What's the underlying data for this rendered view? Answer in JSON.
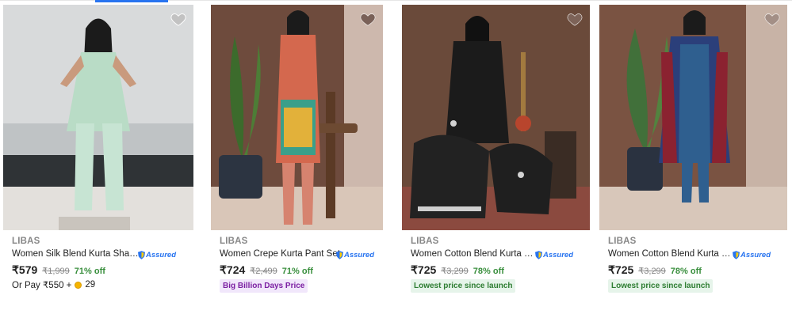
{
  "products": [
    {
      "brand": "LIBAS",
      "title": "Women Silk Blend Kurta Sharara ...",
      "assured_label": "Assured",
      "price": "₹579",
      "mrp": "₹1,999",
      "discount": "71% off",
      "pay_prefix": "Or Pay ₹550 +",
      "pay_coins": "29",
      "tag": "",
      "image_bg": "#c8cbcc",
      "outfit_color": "#b9dcc6"
    },
    {
      "brand": "LIBAS",
      "title": "Women Crepe Kurta Pant Set",
      "assured_label": "Assured",
      "price": "₹724",
      "mrp": "₹2,499",
      "discount": "71% off",
      "pay_prefix": "",
      "pay_coins": "",
      "tag": "Big Billion Days Price",
      "tag_style": "bbd",
      "image_bg": "#6d4a3c",
      "outfit_color": "#d4684e"
    },
    {
      "brand": "LIBAS",
      "title": "Women Cotton Blend Kurta Salw...",
      "assured_label": "Assured",
      "price": "₹725",
      "mrp": "₹3,299",
      "discount": "78% off",
      "pay_prefix": "",
      "pay_coins": "",
      "tag": "Lowest price since launch",
      "tag_style": "low",
      "image_bg": "#6a4a3a",
      "outfit_color": "#1b1b1b"
    },
    {
      "brand": "LIBAS",
      "title": "Women Cotton Blend Kurta Pant ...",
      "assured_label": "Assured",
      "price": "₹725",
      "mrp": "₹3,299",
      "discount": "78% off",
      "pay_prefix": "",
      "pay_coins": "",
      "tag": "Lowest price since launch",
      "tag_style": "low",
      "image_bg": "#7a5342",
      "outfit_color": "#2f5f8f"
    }
  ],
  "colors": {
    "accent": "#2874f0",
    "discount_green": "#388e3c",
    "muted": "#878787"
  },
  "icons": {
    "wishlist": "heart-icon",
    "assured": "flipkart-assured-shield-icon",
    "coin": "supercoin-icon"
  }
}
